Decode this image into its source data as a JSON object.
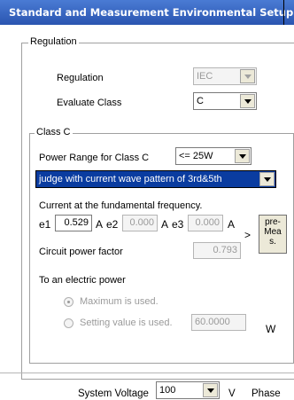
{
  "window": {
    "title": "Standard and Measurement Environmental Setup"
  },
  "regulation_group": {
    "title": "Regulation",
    "regulation_label": "Regulation",
    "regulation_value": "IEC",
    "evaluate_label": "Evaluate Class",
    "evaluate_value": "C"
  },
  "classc_group": {
    "title": "Class C",
    "power_range_label": "Power Range for Class C",
    "power_range_value": "<= 25W",
    "judge_value": "judge with current wave pattern of 3rd&5th",
    "current_label": "Current at the fundamental frequency.",
    "e1_label": "e1",
    "e1_value": "0.529",
    "e2_label": "e2",
    "e2_value": "0.000",
    "e3_label": "e3",
    "e3_value": "0.000",
    "unit_a": "A",
    "arrow": ">",
    "premeas_l1": "pre-",
    "premeas_l2": "Mea",
    "premeas_l3": "s.",
    "pf_label": "Circuit power factor",
    "pf_value": "0.793",
    "electric_power_label": "To an electric power",
    "radio_max": "Maximum is used.",
    "radio_setting": "Setting value is used.",
    "setting_value": "60.0000",
    "unit_w": "W"
  },
  "footer": {
    "system_voltage_label": "System Voltage",
    "system_voltage_value": "100",
    "unit_v": "V",
    "phase_label": "Phase"
  }
}
